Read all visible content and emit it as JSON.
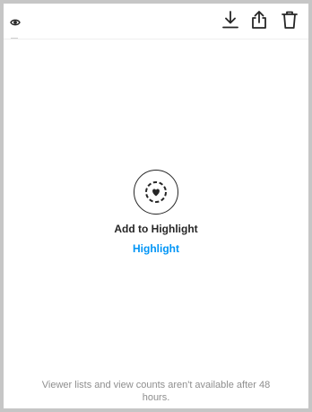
{
  "header": {
    "icons": {
      "viewers": "eye-icon",
      "download": "download-icon",
      "share": "share-icon",
      "delete": "trash-icon"
    }
  },
  "main": {
    "highlight_icon": "highlight-heart-icon",
    "add_label": "Add to Highlight",
    "link_label": "Highlight"
  },
  "footer": {
    "note": "Viewer lists and view counts aren't available after 48 hours."
  },
  "colors": {
    "link": "#0095f6",
    "text": "#262626",
    "muted": "#8e8e8e",
    "background_frame": "#c6c6c6"
  }
}
